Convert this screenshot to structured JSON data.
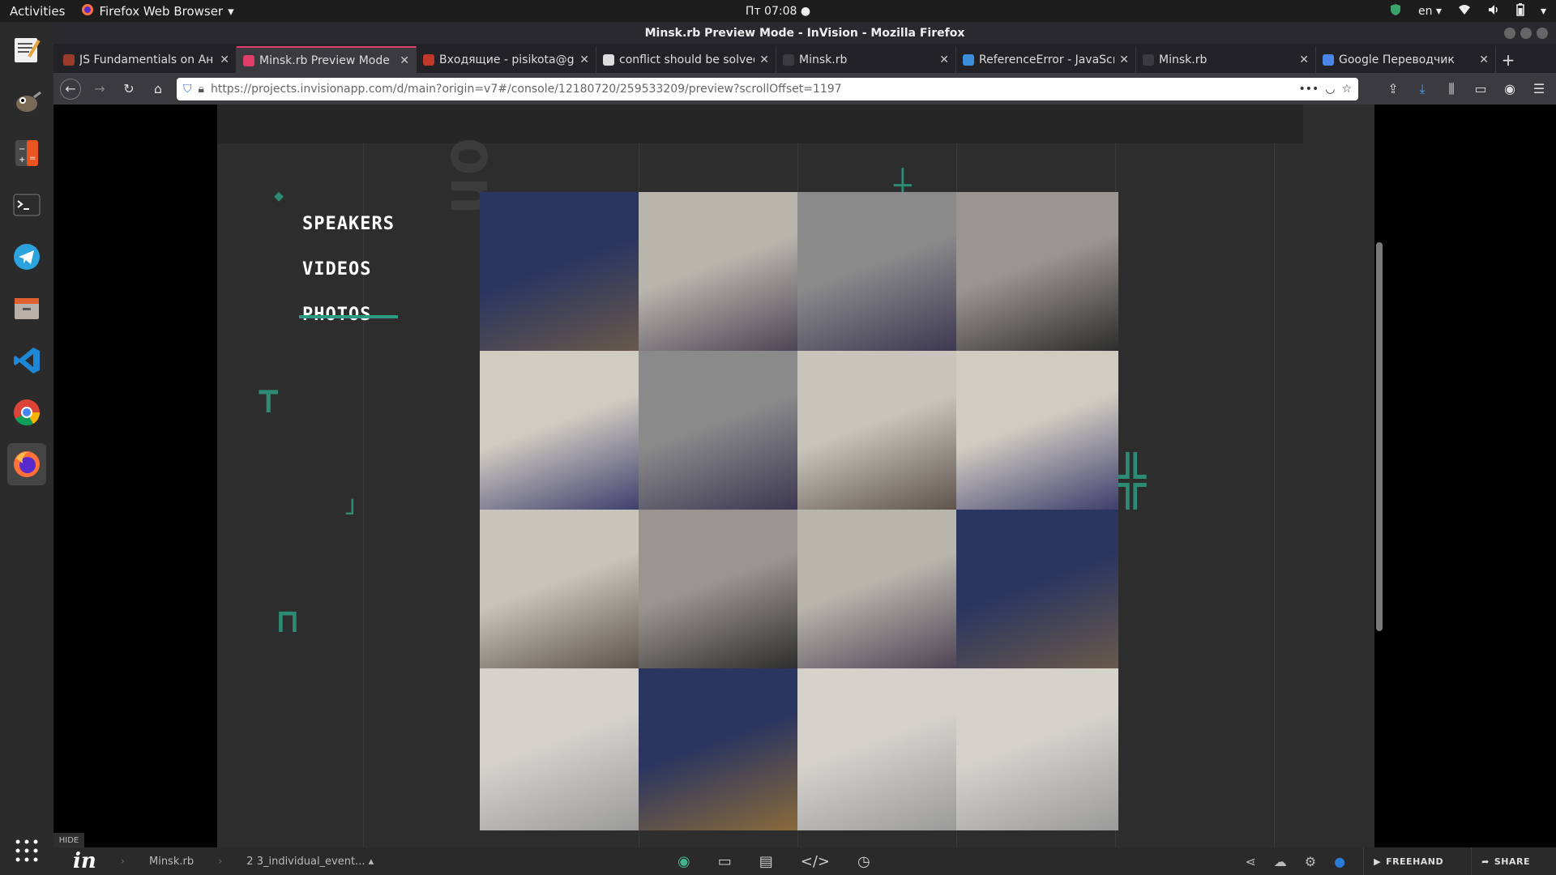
{
  "topbar": {
    "activities": "Activities",
    "app_name": "Firefox Web Browser",
    "clock": "Пт 07:08",
    "lang": "en"
  },
  "window": {
    "title": "Minsk.rb Preview Mode - InVision - Mozilla Firefox"
  },
  "tabs": [
    {
      "title": "JS Fundamentials on Ан",
      "color": "#9b3b2b"
    },
    {
      "title": "Minsk.rb Preview Mode",
      "color": "#e03e6a"
    },
    {
      "title": "Входящие - pisikota@gn",
      "color": "#c0392b"
    },
    {
      "title": "conflict should be solved",
      "color": "#ddd"
    },
    {
      "title": "Minsk.rb",
      "color": "#3b3b3f"
    },
    {
      "title": "ReferenceError - JavaScr",
      "color": "#3a8fd8"
    },
    {
      "title": "Minsk.rb",
      "color": "#3b3b3f"
    },
    {
      "title": "Google Переводчик",
      "color": "#4a86e8"
    }
  ],
  "urlbar": {
    "url": "https://projects.invisionapp.com/d/main?origin=v7#/console/12180720/259533209/preview?scrollOffset=1197"
  },
  "page": {
    "nav_speakers": "SPEAKERS",
    "nav_videos": "VIDEOS",
    "nav_photos": "PHOTOS"
  },
  "bottom": {
    "hide": "HIDE",
    "project": "Minsk.rb",
    "screen": "2 3_individual_event...",
    "freehand": "FREEHAND",
    "share": "SHARE"
  },
  "photos": [
    {
      "a": "#2a3560",
      "b": "#6a5a4a"
    },
    {
      "a": "#b8b5ad",
      "b": "#4a4050"
    },
    {
      "a": "#8a8a8a",
      "b": "#3a3550"
    },
    {
      "a": "#9a9590",
      "b": "#2a2a2a"
    },
    {
      "a": "#d0ccc2",
      "b": "#3a3a6a"
    },
    {
      "a": "#8a8a8a",
      "b": "#3a3550"
    },
    {
      "a": "#c8c4bc",
      "b": "#5a5048"
    },
    {
      "a": "#d0ccc2",
      "b": "#3a3a6a"
    },
    {
      "a": "#c8c4bc",
      "b": "#5a5048"
    },
    {
      "a": "#9a9590",
      "b": "#2a2a2a"
    },
    {
      "a": "#b8b5ad",
      "b": "#4a4050"
    },
    {
      "a": "#2a3560",
      "b": "#6a5a4a"
    },
    {
      "a": "#d5d2cc",
      "b": "#9a9a9a"
    },
    {
      "a": "#2a3560",
      "b": "#8a6a3a"
    },
    {
      "a": "#d5d2cc",
      "b": "#9a9a9a"
    },
    {
      "a": "#d5d2cc",
      "b": "#9a9a9a"
    }
  ]
}
